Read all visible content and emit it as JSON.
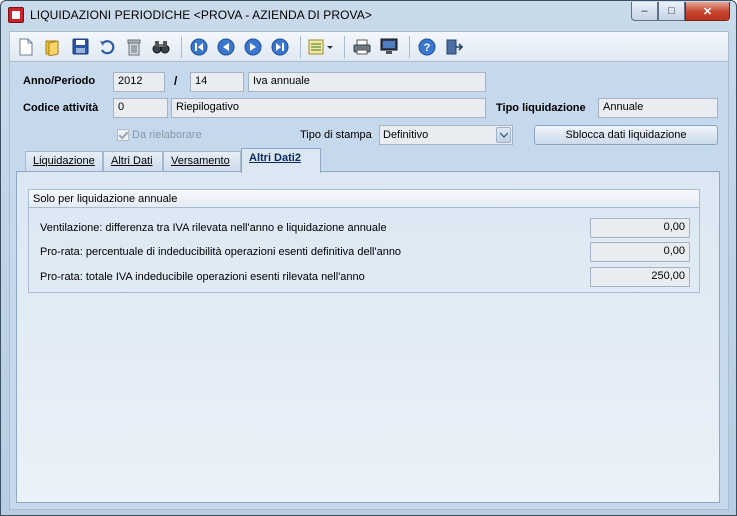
{
  "window": {
    "title": "LIQUIDAZIONI PERIODICHE <PROVA - AZIENDA DI PROVA>",
    "minimize": "–",
    "maximize": "□",
    "close": "✕"
  },
  "toolbar": {
    "icons": [
      "new-icon",
      "open-icon",
      "save-icon",
      "undo-icon",
      "delete-icon",
      "find-icon",
      "first-record-icon",
      "previous-record-icon",
      "next-record-icon",
      "last-record-icon",
      "options-icon",
      "print-icon",
      "preview-icon",
      "help-icon",
      "exit-icon"
    ]
  },
  "form": {
    "anno_periodo_label": "Anno/Periodo",
    "anno": "2012",
    "separator": "/",
    "periodo": "14",
    "periodo_descr": "Iva annuale",
    "codice_attivita_label": "Codice attività",
    "codice_attivita": "0",
    "codice_attivita_descr": "Riepilogativo",
    "tipo_liquidazione_label": "Tipo liquidazione",
    "tipo_liquidazione": "Annuale",
    "da_rielaborare_label": "Da rielaborare",
    "tipo_stampa_label": "Tipo di stampa",
    "tipo_stampa": "Definitivo",
    "sblocca_button": "Sblocca dati liquidazione"
  },
  "tabs": [
    {
      "label": "Liquidazione"
    },
    {
      "label": "Altri Dati"
    },
    {
      "label": "Versamento"
    },
    {
      "label": "Altri Dati2"
    }
  ],
  "group": {
    "title": "Solo per liquidazione annuale",
    "rows": [
      {
        "label": "Ventilazione: differenza tra IVA rilevata nell'anno e liquidazione annuale",
        "value": "0,00"
      },
      {
        "label": "Pro-rata: percentuale di indeducibilità operazioni esenti definitiva dell'anno",
        "value": "0,00"
      },
      {
        "label": "Pro-rata: totale IVA indeducibile operazioni esenti rilevata nell'anno",
        "value": "250,00"
      }
    ]
  }
}
